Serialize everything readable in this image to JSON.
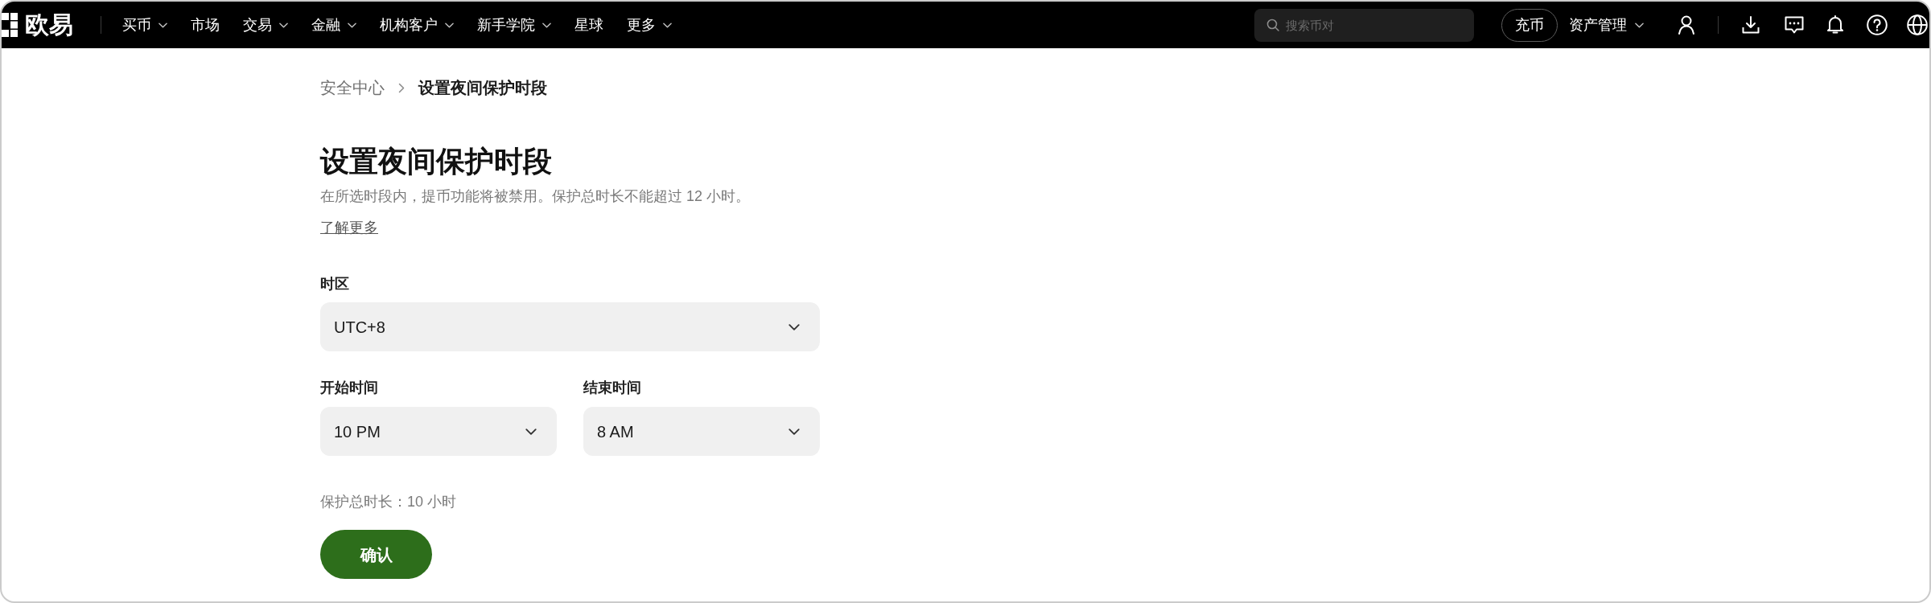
{
  "nav": {
    "logo": "欧易",
    "menu": [
      {
        "label": "买币",
        "dropdown": true
      },
      {
        "label": "市场",
        "dropdown": false
      },
      {
        "label": "交易",
        "dropdown": true
      },
      {
        "label": "金融",
        "dropdown": true
      },
      {
        "label": "机构客户",
        "dropdown": true
      },
      {
        "label": "新手学院",
        "dropdown": true
      },
      {
        "label": "星球",
        "dropdown": false
      },
      {
        "label": "更多",
        "dropdown": true
      }
    ],
    "search": {
      "placeholder": "搜索币对"
    },
    "deposit_button": "充币",
    "assets_menu": {
      "label": "资产管理",
      "dropdown": true
    }
  },
  "breadcrumb": [
    {
      "label": "安全中心",
      "current": false
    },
    {
      "label": "设置夜间保护时段",
      "current": true
    }
  ],
  "title": "设置夜间保护时段",
  "description": "在所选时段内，提币功能将被禁用。保护总时长不能超过 12 小时。",
  "learn_more_link": "了解更多",
  "form": {
    "timezone": {
      "label": "时区",
      "value": "UTC+8"
    },
    "times": [
      {
        "label": "开始时间",
        "value": "10 PM"
      },
      {
        "label": "结束时间",
        "value": "8 AM"
      }
    ],
    "total_duration": "保护总时长：10 小时",
    "confirm_button": "确认"
  }
}
